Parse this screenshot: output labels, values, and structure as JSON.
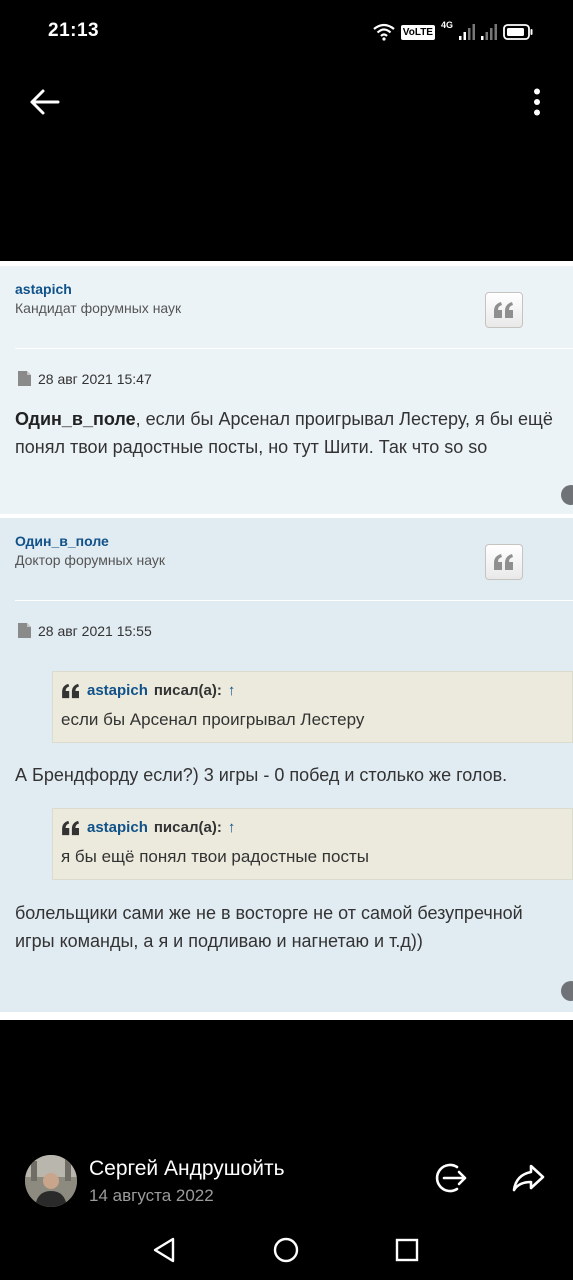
{
  "status": {
    "time": "21:13",
    "volte": "VoLTE",
    "network": "4G"
  },
  "posts": [
    {
      "author": "astapich",
      "rank": "Кандидат форумных наук",
      "date": "28 авг 2021 15:47",
      "body": {
        "mention": "Один_в_поле",
        "text": ", если бы Арсенал проигрывал Лестеру, я бы ещё понял твои радостные посты, но тут Шити. Так что so so"
      }
    },
    {
      "author": "Один_в_поле",
      "rank": "Доктор форумных наук",
      "date": "28 авг 2021 15:55",
      "quotes": [
        {
          "author": "astapich",
          "wrote": "писал(а):",
          "arrow": "↑",
          "text": "если бы Арсенал проигрывал Лестеру"
        },
        {
          "author": "astapich",
          "wrote": "писал(а):",
          "arrow": "↑",
          "text": "я бы ещё понял твои радостные посты"
        }
      ],
      "paragraphs": [
        "А Брендфорду если?) 3 игры - 0 побед и столько же голов.",
        "болельщики сами же не в восторге не от самой безупречной игры команды, а я и подливаю и нагнетаю и т.д))"
      ]
    }
  ],
  "share_bar": {
    "user": "Сергей Андрушойть",
    "date": "14 августа 2022"
  }
}
